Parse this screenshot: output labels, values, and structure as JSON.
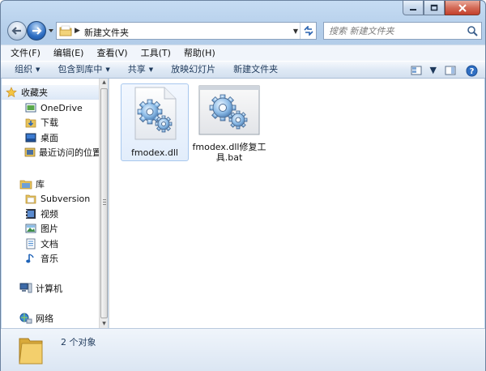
{
  "window": {
    "caption_buttons": [
      "minimize",
      "maximize",
      "close"
    ]
  },
  "address": {
    "path": "新建文件夹"
  },
  "search": {
    "placeholder": "搜索 新建文件夹"
  },
  "menu": {
    "items": [
      "文件(F)",
      "编辑(E)",
      "查看(V)",
      "工具(T)",
      "帮助(H)"
    ]
  },
  "commands": {
    "organize": "组织",
    "include_library": "包含到库中",
    "share": "共享",
    "slideshow": "放映幻灯片",
    "new_folder": "新建文件夹"
  },
  "nav": {
    "favorites": "收藏夹",
    "onedrive": "OneDrive",
    "downloads": "下载",
    "desktop": "桌面",
    "recent": "最近访问的位置",
    "libraries": "库",
    "subversion": "Subversion",
    "videos": "视频",
    "pictures": "图片",
    "documents": "文档",
    "music": "音乐",
    "computer": "计算机",
    "network": "网络"
  },
  "files": [
    {
      "name": "fmodex.dll",
      "icon": "gear-dll-icon",
      "selected": true
    },
    {
      "name": "fmodex.dll修复工具.bat",
      "icon": "gear-bat-icon",
      "selected": false
    }
  ],
  "status": {
    "item_count": "2 个对象"
  },
  "colors": {
    "accent": "#1e395b",
    "selection_border": "#a8c8ee"
  }
}
